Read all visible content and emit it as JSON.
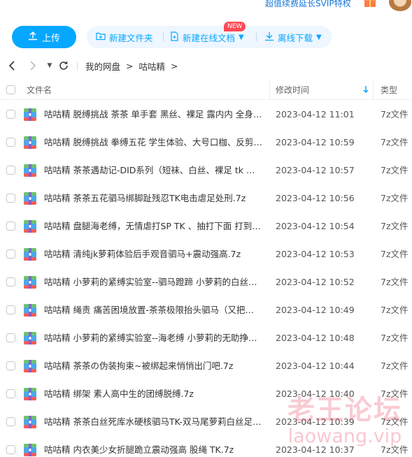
{
  "topbar": {
    "promo": "超值续费延长SVIP特权",
    "gift_icon": "gift-icon",
    "avatar": "user-avatar"
  },
  "toolbar": {
    "upload_label": "上传",
    "new_folder_label": "新建文件夹",
    "new_online_doc_label": "新建在线文档",
    "new_badge": "NEW",
    "offline_download_label": "离线下载",
    "accent": "#06a7ff"
  },
  "nav": {
    "root": "我的网盘",
    "sep": ">",
    "folder": "咕咕精",
    "trail_sep": ">"
  },
  "table": {
    "col_name": "文件名",
    "col_modified": "修改时间",
    "col_type": "类型",
    "sort_icon": "arrow-down-icon",
    "rows": [
      {
        "name": "咕咕精 脱缚挑战 茶茶 单手套 黑丝、裸足 露内内 全身爱...",
        "date": "2023-04-12 11:01",
        "type": "7z文件"
      },
      {
        "name": "咕咕精 脱缚挑战 拳缚五花 学生体验、大号口枷、反剪双...",
        "date": "2023-04-12 10:59",
        "type": "7z文件"
      },
      {
        "name": "咕咕精 茶茶遇劫记-DID系列（短袜、白丝、裸足 tk 电击...",
        "date": "2023-04-12 10:57",
        "type": "7z文件"
      },
      {
        "name": "咕咕精 茶茶五花驷马绑脚趾残忍TK电击虐足处刑.7z",
        "date": "2023-04-12 10:56",
        "type": "7z文件"
      },
      {
        "name": "咕咕精 盘腿海老缚，无情虐打SP TK 、抽打下面 打到哭...",
        "date": "2023-04-12 10:54",
        "type": "7z文件"
      },
      {
        "name": "咕咕精 清纯jk萝莉体验后手观音驷马+震动强高.7z",
        "date": "2023-04-12 10:53",
        "type": "7z文件"
      },
      {
        "name": "咕咕精 小萝莉的紧缚实验室--驷马蹬蹄 小萝莉的白丝嫩...",
        "date": "2023-04-12 10:52",
        "type": "7z文件"
      },
      {
        "name": "咕咕精 绳责 痛苦困境放置-茶茶极限抬头驷马（又把小萝...",
        "date": "2023-04-12 10:49",
        "type": "7z文件"
      },
      {
        "name": "咕咕精 小萝莉的紧缚实验室--海老缚 小萝莉的无助挣扎 ...",
        "date": "2023-04-12 10:48",
        "type": "7z文件"
      },
      {
        "name": "咕咕精 茶茶の伪装拘束~被绑起来悄悄出门吧.7z",
        "date": "2023-04-12 10:44",
        "type": "7z文件"
      },
      {
        "name": "咕咕精 绑架 素人高中生的团缚脱缚.7z",
        "date": "2023-04-12 10:40",
        "type": "7z文件"
      },
      {
        "name": "咕咕精 茶茶白丝死库水硬核驷马TK-双马尾萝莉白丝足底...",
        "date": "2023-04-12 10:39",
        "type": "7z文件"
      },
      {
        "name": "咕咕精 内衣美少女折腿跪立震动强高 股绳 TK.7z",
        "date": "2023-04-12 10:37",
        "type": "7z文件"
      }
    ]
  },
  "watermark": {
    "line1": "老王论坛",
    "line2": "laowang.vip"
  }
}
